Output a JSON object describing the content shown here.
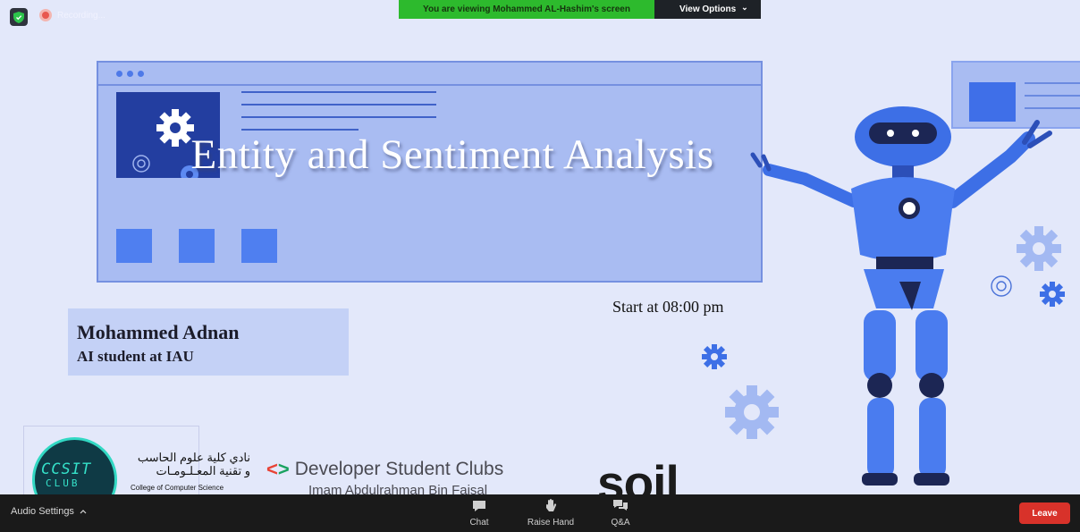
{
  "meeting": {
    "recording_label": "Recording...",
    "banner_text": "You are viewing Mohammed AL-Hashim's screen",
    "view_options_label": "View Options",
    "chevron_glyph": "⌄"
  },
  "slide": {
    "title": "Entity and Sentiment Analysis",
    "start_time": "Start at 08:00 pm",
    "presenter_name": "Mohammed Adnan",
    "presenter_role": "AI student at IAU",
    "ccsit_logo": "CCSIT",
    "ccsit_club": "CLUB",
    "ccsit_arabic_line1": "نادي كلية علوم الحاسب",
    "ccsit_arabic_line2": "و تقنية المعـلـومـات",
    "ccsit_english": "College of Computer Science",
    "dsc_brackets": "<>",
    "dsc_name": "Developer Student Clubs",
    "dsc_subtitle": "Imam Abdulrahman Bin Faisal",
    "soil_logo": "soil",
    "colors": {
      "background": "#e3e8fa",
      "card": "#a9bcf2",
      "accent_blue": "#4f7ff0",
      "dark_blue": "#233ea0"
    }
  },
  "controls": {
    "audio_settings": "Audio Settings",
    "chat": "Chat",
    "raise_hand": "Raise Hand",
    "qa": "Q&A",
    "leave": "Leave"
  },
  "icons": {
    "security": "shield-icon",
    "record": "record-icon",
    "chat": "chat-icon",
    "raise_hand": "hand-icon",
    "qa": "qa-icon"
  }
}
